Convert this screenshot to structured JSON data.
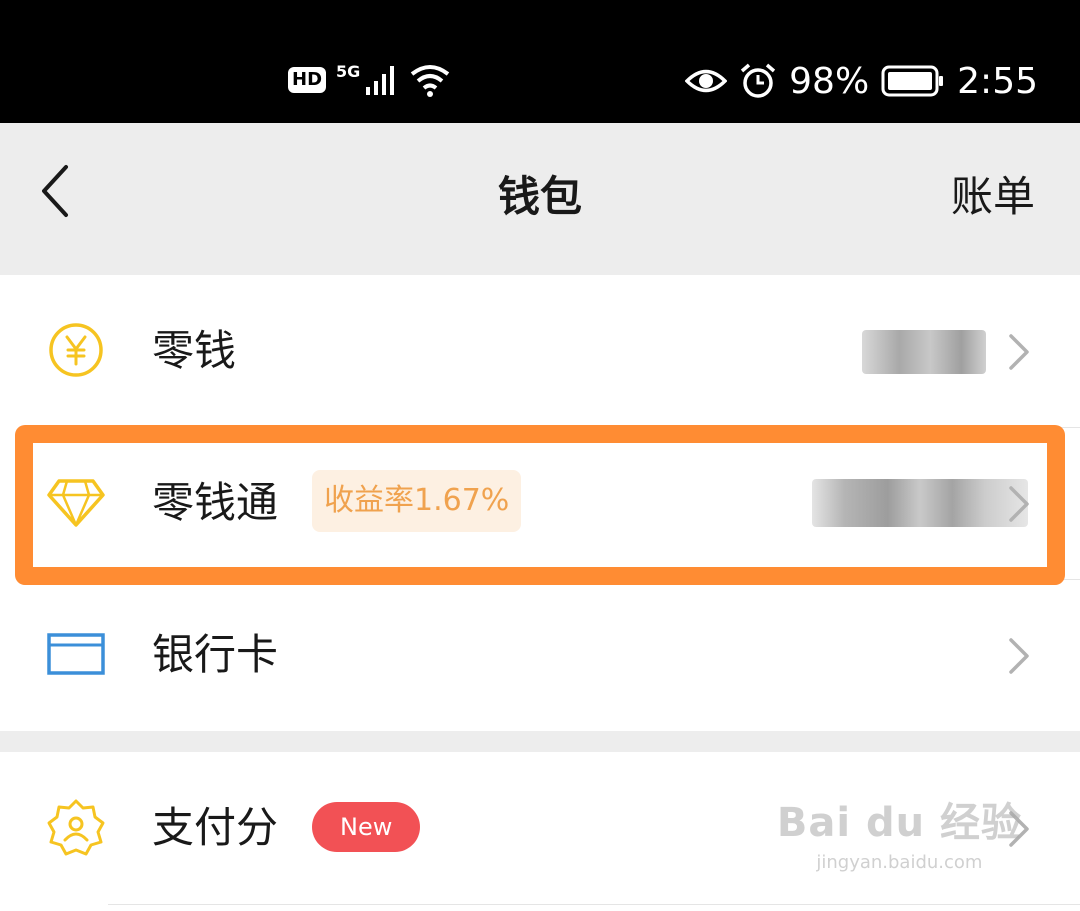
{
  "status_bar": {
    "hd_label": "HD",
    "network_label": "5G",
    "battery_percent": "98%",
    "time": "2:55",
    "icons": [
      "hd-icon",
      "signal-icon",
      "wifi-icon",
      "eye-icon",
      "alarm-icon",
      "battery-icon"
    ]
  },
  "nav": {
    "title": "钱包",
    "right_action": "账单",
    "back_icon": "chevron-left-icon"
  },
  "items": [
    {
      "label": "零钱",
      "icon": "yuan-coin-icon",
      "value_hidden": true
    },
    {
      "label": "零钱通",
      "badge": "收益率1.67%",
      "icon": "diamond-icon",
      "value_hidden": true,
      "highlighted": true
    },
    {
      "label": "银行卡",
      "icon": "bank-card-icon"
    },
    {
      "label": "支付分",
      "badge": "New",
      "icon": "badge-user-icon"
    }
  ],
  "colors": {
    "accent_yellow": "#f6c421",
    "highlight_orange": "#ff8c33",
    "badge_rate_bg": "#fdf0e2",
    "badge_rate_text": "#f0a24e",
    "badge_new_bg": "#f25155",
    "card_blue": "#3b8fd9"
  },
  "watermark": {
    "brand": "Bai du 经验",
    "url": "jingyan.baidu.com"
  }
}
